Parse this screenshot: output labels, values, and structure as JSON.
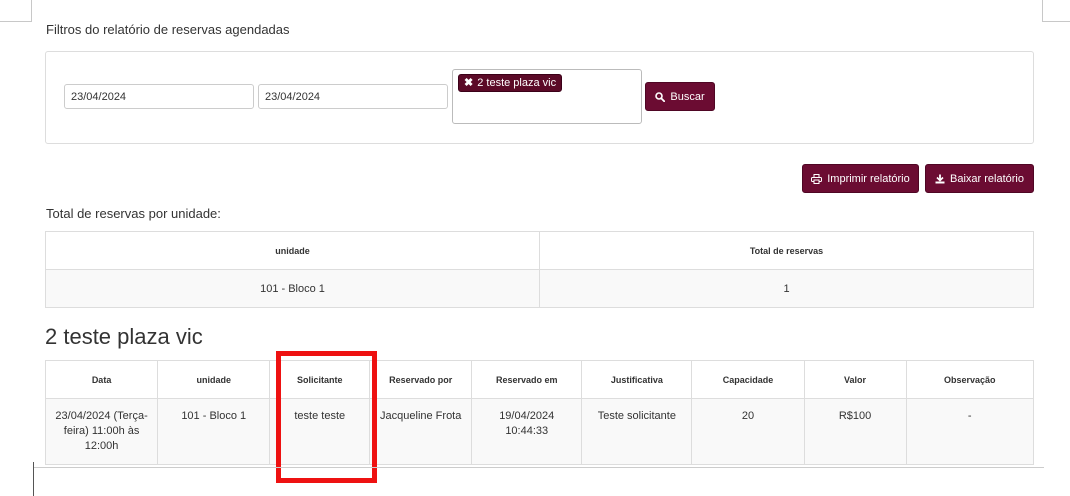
{
  "filters": {
    "title": "Filtros do relatório de reservas agendadas",
    "date_from": "23/04/2024",
    "date_to": "23/04/2024",
    "selected_tags": [
      "2 teste plaza vic"
    ],
    "tag_remove_icon": "close-icon",
    "search_label": "Buscar",
    "search_icon": "search-icon"
  },
  "actions": {
    "print_label": "Imprimir relatório",
    "print_icon": "printer-icon",
    "download_label": "Baixar relatório",
    "download_icon": "download-icon"
  },
  "totals": {
    "title": "Total de reservas por unidade:",
    "headers": [
      "unidade",
      "Total de reservas"
    ],
    "rows": [
      [
        "101 - Bloco 1",
        "1"
      ]
    ]
  },
  "reservations": {
    "heading": "2 teste plaza vic",
    "headers": [
      "Data",
      "unidade",
      "Solicitante",
      "Reservado por",
      "Reservado em",
      "Justificativa",
      "Capacidade",
      "Valor",
      "Observação"
    ],
    "rows": [
      {
        "data_lines": [
          "23/04/2024 (Terça-",
          "feira) 11:00h às",
          "12:00h"
        ],
        "unidade": "101 - Bloco 1",
        "solicitante": "teste teste",
        "reservado_por": "Jacqueline Frota",
        "reservado_em_lines": [
          "19/04/2024",
          "10:44:33"
        ],
        "justificativa": "Teste solicitante",
        "capacidade": "20",
        "valor": "R$100",
        "observacao": "-"
      }
    ]
  },
  "colors": {
    "accent": "#6b0c32",
    "highlight": "#ee1111",
    "border": "#dddddd"
  }
}
